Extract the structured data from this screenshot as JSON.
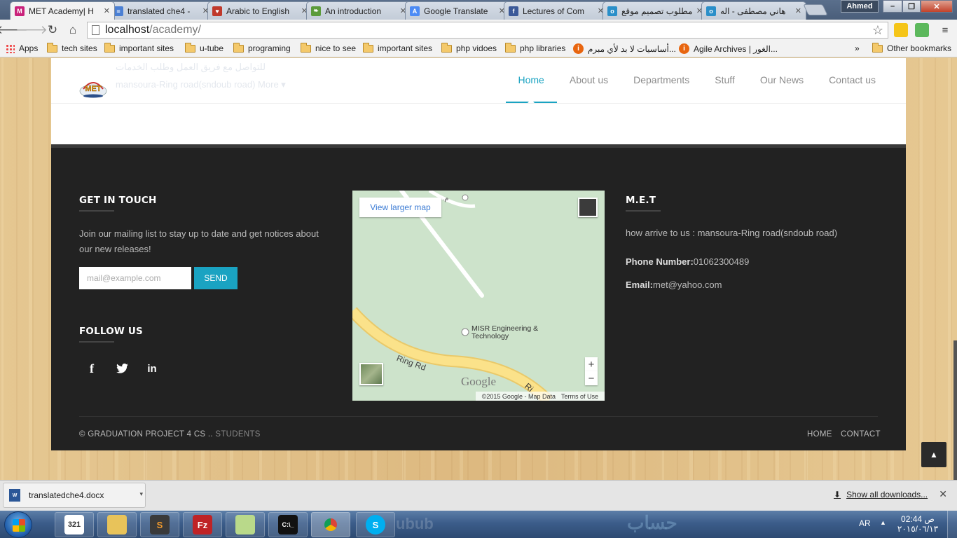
{
  "browser": {
    "tabs": [
      {
        "title": "MET Academy| H",
        "favicon_color": "#c9217a",
        "favicon_glyph": "M",
        "active": true
      },
      {
        "title": "translated che4 -",
        "favicon_color": "#4a7fd4",
        "favicon_glyph": "≡",
        "active": false
      },
      {
        "title": "Arabic to English",
        "favicon_color": "#c0392b",
        "favicon_glyph": "♥",
        "active": false
      },
      {
        "title": "An introduction",
        "favicon_color": "#5b9b3a",
        "favicon_glyph": "❧",
        "active": false
      },
      {
        "title": "Google Translate",
        "favicon_color": "#4c8bf5",
        "favicon_glyph": "A",
        "active": false
      },
      {
        "title": "Lectures of Com",
        "favicon_color": "#3b5998",
        "favicon_glyph": "f",
        "active": false
      },
      {
        "title": "مطلوب تصميم موقع",
        "favicon_color": "#2a8fc9",
        "favicon_glyph": "o",
        "active": false
      },
      {
        "title": "هاني مصطفى - اله",
        "favicon_color": "#2a8fc9",
        "favicon_glyph": "o",
        "active": false
      }
    ],
    "profile_name": "Ahmed",
    "window_buttons": {
      "minimize": "–",
      "maximize": "❐",
      "close": "✕"
    },
    "address": {
      "host": "localhost",
      "path": "/academy/"
    },
    "bookmarks": [
      {
        "label": "Apps",
        "icon": "apps-grid-icon"
      },
      {
        "label": "tech sites",
        "icon": "folder-icon"
      },
      {
        "label": "important sites",
        "icon": "folder-icon"
      },
      {
        "label": "u-tube",
        "icon": "folder-icon"
      },
      {
        "label": "programing",
        "icon": "folder-icon"
      },
      {
        "label": "nice to see",
        "icon": "folder-icon"
      },
      {
        "label": "important sites",
        "icon": "folder-icon"
      },
      {
        "label": "php vidoes",
        "icon": "folder-icon"
      },
      {
        "label": "php libraries",
        "icon": "folder-icon"
      },
      {
        "label": "أساسيات لا بد لأي مبرم...",
        "icon": "bookmark-orange-icon"
      },
      {
        "label": "Agile Archives | الغور...",
        "icon": "bookmark-orange-icon"
      }
    ],
    "bookmarks_overflow": "»",
    "other_bookmarks": "Other bookmarks"
  },
  "page": {
    "header_ghost_line1": "للتواصل مع فريق العمل وطلب الخدمات",
    "header_ghost_line2": "mansoura-Ring road(sndoub road) More ▾",
    "logo_text": "MET",
    "nav": [
      {
        "label": "Home",
        "active": true
      },
      {
        "label": "About us",
        "active": false
      },
      {
        "label": "Departments",
        "active": false
      },
      {
        "label": "Stuff",
        "active": false
      },
      {
        "label": "Our News",
        "active": false
      },
      {
        "label": "Contact us",
        "active": false
      }
    ],
    "footer": {
      "get_in_touch": {
        "title": "GET IN TOUCH",
        "text": "Join our mailing list to stay up to date and get notices about our new releases!",
        "email_placeholder": "mail@example.com",
        "send_label": "SEND"
      },
      "follow_us": {
        "title": "FOLLOW US",
        "icons": [
          "facebook-icon",
          "twitter-icon",
          "linkedin-icon"
        ]
      },
      "map": {
        "view_larger": "View larger map",
        "top_label": "م. مه",
        "place_label": "MISR Engineering & Technology",
        "road_label": "Ring Rd",
        "road_end_label": "Ri",
        "brand": "Google",
        "attribution": "©2015 Google - Map Data",
        "terms": "Terms of Use",
        "zoom_in": "+",
        "zoom_out": "−"
      },
      "met": {
        "title": "M.E.T",
        "address": "how arrive to us : mansoura-Ring road(sndoub road)",
        "phone_label": "Phone Number:",
        "phone": "01062300489",
        "email_label": "Email:",
        "email": "met@yahoo.com"
      },
      "copyright_main": "© GRADUATION PROJECT 4 CS ..",
      "copyright_dim": "STUDENTS",
      "links": [
        "HOME",
        "CONTACT"
      ]
    },
    "back_to_top": "▲"
  },
  "download_shelf": {
    "filename": "translatedche4.docx",
    "show_all": "Show all downloads...",
    "close": "✕"
  },
  "taskbar": {
    "tasks": [
      "calendar-app",
      "file-explorer",
      "sublime-text",
      "filezilla",
      "sticky-notes",
      "command-prompt",
      "chrome",
      "skype"
    ],
    "language": "AR",
    "time": "02:44 ص",
    "date": "٢٠١٥/٠٦/١٣",
    "watermark": "ubub",
    "watermark2": "حساب"
  },
  "colors": {
    "accent": "#1aa3c2",
    "footer_bg": "#222222",
    "wood": "#e2c48e"
  }
}
